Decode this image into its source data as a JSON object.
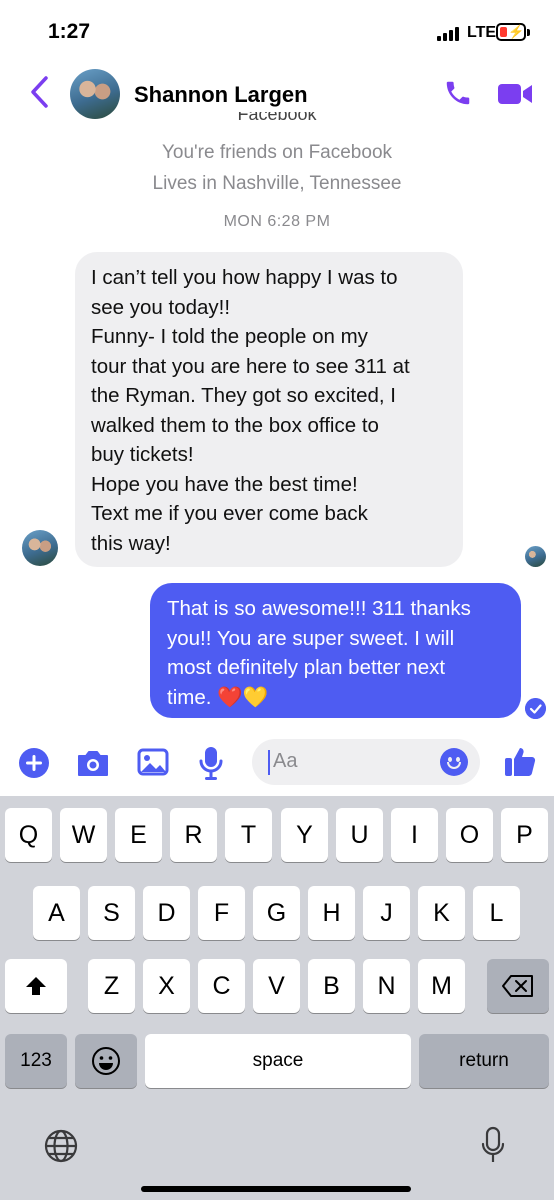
{
  "status_bar": {
    "time": "1:27",
    "network": "LTE",
    "battery_color": "#ff3b30"
  },
  "header": {
    "contact_name": "Shannon Largen",
    "accent": "#7b3ef0",
    "icons": [
      "back-chevron-icon",
      "phone-icon",
      "video-camera-icon"
    ]
  },
  "profile_info": {
    "partial_line": "Facebook",
    "friends": "You're friends on Facebook",
    "location": "Lives in Nashville, Tennessee"
  },
  "thread": {
    "timestamp": "MON 6:28 PM",
    "incoming": {
      "lines": [
        "I can’t tell you how happy I was to",
        "see you today!!",
        "Funny- I told the people on my",
        "tour that you are here to see 311 at",
        "the Ryman. They got so excited, I",
        "walked them to the box office to",
        "buy tickets!",
        "Hope you have the best time!",
        "Text me if you ever come back",
        "this way!"
      ]
    },
    "outgoing": {
      "lines": [
        "That is so awesome!!! 311 thanks",
        "you!! You are super sweet. I will",
        "most definitely plan better next",
        "time. ❤️💛"
      ],
      "bubble_color": "#4e5cf2"
    }
  },
  "composer": {
    "placeholder": "Aa",
    "icons": [
      "plus-icon",
      "camera-icon",
      "image-icon",
      "microphone-icon",
      "emoji-icon",
      "thumbs-up-icon"
    ]
  },
  "keyboard": {
    "row1": [
      "Q",
      "W",
      "E",
      "R",
      "T",
      "Y",
      "U",
      "I",
      "O",
      "P"
    ],
    "row2": [
      "A",
      "S",
      "D",
      "F",
      "G",
      "H",
      "J",
      "K",
      "L"
    ],
    "row3": [
      "Z",
      "X",
      "C",
      "V",
      "B",
      "N",
      "M"
    ],
    "numbers_label": "123",
    "space_label": "space",
    "return_label": "return",
    "icons": [
      "shift-icon",
      "backspace-icon",
      "emoji-keyboard-icon",
      "globe-icon",
      "dictation-icon"
    ]
  }
}
